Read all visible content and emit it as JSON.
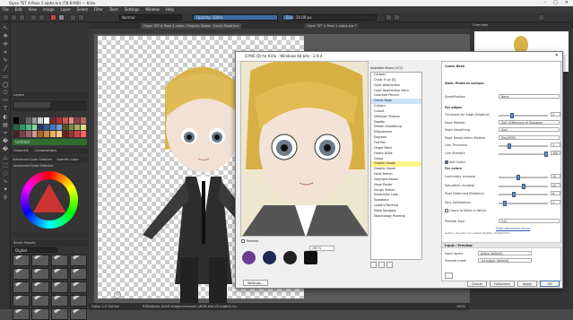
{
  "window": {
    "title": "Gipsx TET A Pose 2 alpha.kra (78.8 MiB) — Krita"
  },
  "menu": [
    "File",
    "Edit",
    "View",
    "Image",
    "Layer",
    "Select",
    "Filter",
    "Tools",
    "Settings",
    "Window",
    "Help"
  ],
  "toolbar": {
    "blend_mode": "Normal",
    "opacity_label": "Opacity: 100%",
    "size_label": "Size: 10.00 px"
  },
  "document_tabs": [
    "Gipsx TET A Pose 2 alpha / Graphic Boost - Comic Book.kra",
    "Gipsx TET A Pose 2 alpha.kra *"
  ],
  "left_dock": {
    "layers_title": "Layers",
    "layer_name": "Untitled",
    "channel_tabs": [
      "Channels",
      "Compositions"
    ],
    "color_title": "Advanced Color Selector",
    "color_tabs": [
      "Advanced Color Selector",
      "Specific Color Selector"
    ],
    "brush_title": "Brush Presets",
    "brush_tag": "Digital"
  },
  "right_dock": {
    "overview_title": "Overview"
  },
  "status": {
    "left": "Gipsx 1.0 Outline",
    "center": "RGB/Alpha (8-bit integer/channel)  sRGB-elle-V2-srgbtrc.icc",
    "zoom": "100%"
  },
  "dialog": {
    "title": "G'MIC-Qt for Krita - Windows 64 bits - 2.9.4",
    "filters_header": "Available filters (572)",
    "filters": [
      "Cartoon",
      "Chalk It Up [S]",
      "Color Abstraction",
      "Color Abstraction Paint",
      "Coloured Pencils",
      "Comic Book",
      "Cubism",
      "Cutout",
      "Diffusion Tensors",
      "Doodle",
      "Dream Smoothing",
      "Ellipsionism",
      "Engrave",
      "Felt Pen",
      "Finger Paint",
      "Freaky B&W",
      "Ghost",
      "Graphic Boost",
      "Graphic Novel",
      "Hard Sketch",
      "Highlight Bloom",
      "Hope Poster",
      "Hough Sketch",
      "Illustration Look",
      "Kuwahara",
      "Lylejk's Painting",
      "Make Squiggly",
      "Morphology Painting"
    ],
    "selected_filter": "Comic Book",
    "highlighted_filter": "Graphic Boost",
    "preview_label": "Preview",
    "preview_zoom": "100 %",
    "logo_labels": [
      "G'MIC",
      "CNRS",
      "GREYC",
      "ENSI CAEN"
    ],
    "settings_button": "Settings...",
    "params": {
      "title": "Comic Book",
      "note": "Note: Photo to cartoon",
      "simplification_label": "Simplification",
      "simplification_value": "None",
      "for_edges": "For edges",
      "edge_rows": [
        {
          "label": "Thickness for Edge (Bilateral)",
          "value": "2",
          "fraction": 0.25
        },
        {
          "label": "Edge Method",
          "value": "DoG (Difference of Gaussian)",
          "select": true
        },
        {
          "label": "Edge Smoothing",
          "value": "DoG"
        },
        {
          "label": "Edge Desaturation Method",
          "value": "Max(RGB)",
          "select": true
        },
        {
          "label": "Line Thickness",
          "value": "1",
          "fraction": 0.2
        },
        {
          "label": "Line Strength",
          "value": "100",
          "fraction": 1.0
        }
      ],
      "add_colors": "Add Colors",
      "for_colors": "For colors",
      "color_rows": [
        {
          "label": "Luminosity Increase",
          "value": "10",
          "fraction": 0.4
        },
        {
          "label": "Saturation Increase",
          "value": "20",
          "fraction": 0.5
        },
        {
          "label": "Pixel Flattening (Bilateral)",
          "value": "6",
          "fraction": 0.3
        },
        {
          "label": "Very Unflattened",
          "value": "1",
          "fraction": 0.1
        }
      ],
      "colors_bw": "Colors to Black or White",
      "preview_type_label": "Preview Type",
      "preview_type_value": "Full",
      "link_text": "Filter discussion forum",
      "author": "Author: Claude Lion. Latest Update: 2019/07/14"
    },
    "io_header": "Input / Preview",
    "input_layers_label": "Input layers",
    "input_layers_value": "Active (default)",
    "output_mode_label": "Preview mode",
    "output_mode_value": "1st output (default)",
    "buttons": {
      "cancel": "Cancel",
      "fullscreen": "Fullscreen",
      "apply": "Apply",
      "ok": "OK"
    }
  },
  "colors": {
    "accent": "#3b6ea5",
    "dialog_bg": "#efefef",
    "highlight": "#fff48a",
    "selected": "#cde4f7"
  }
}
